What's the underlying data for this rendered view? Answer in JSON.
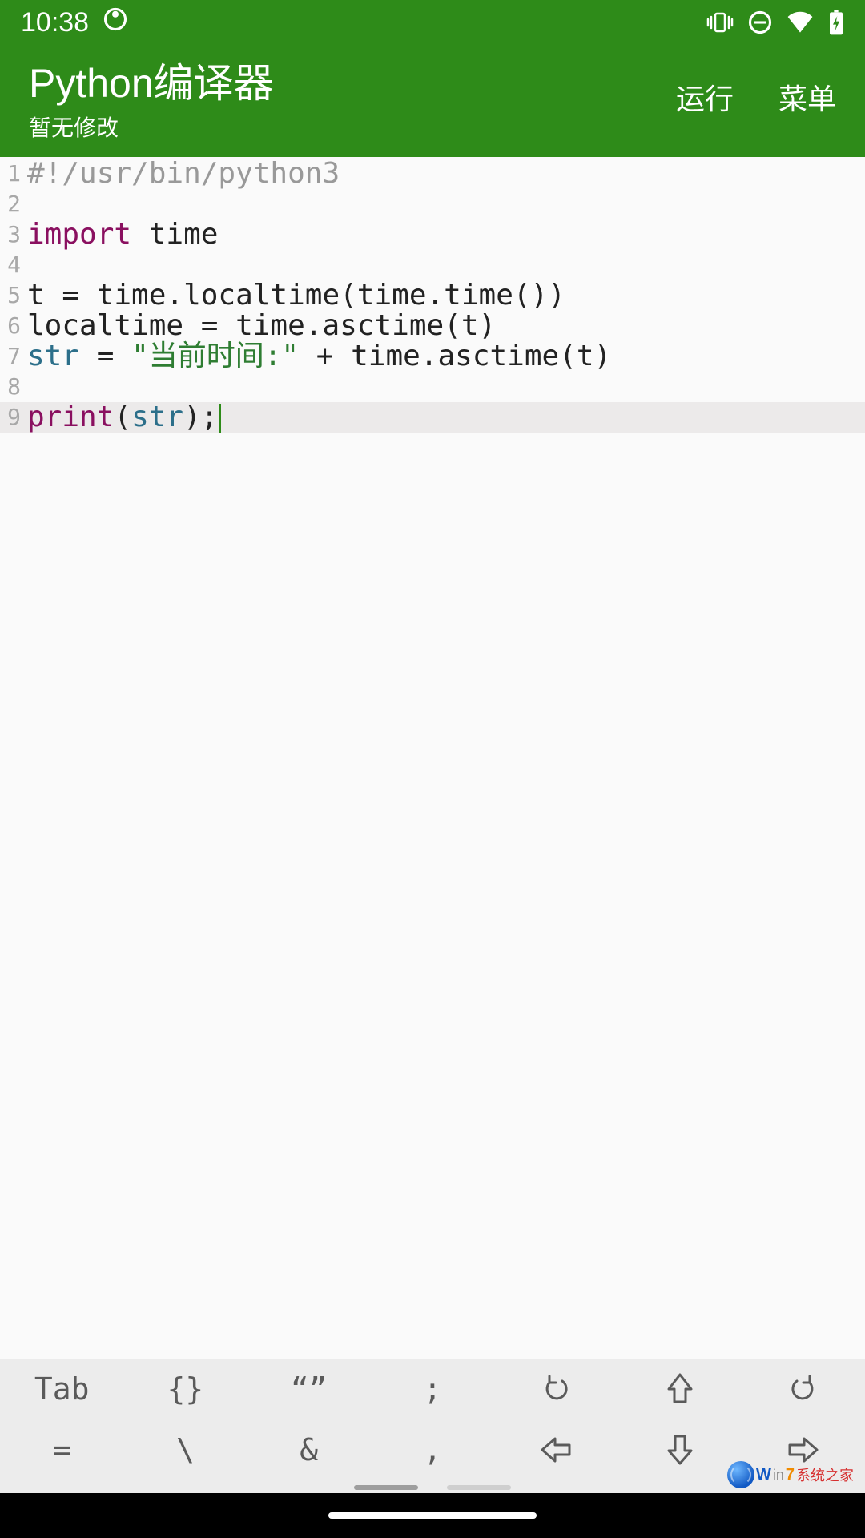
{
  "status": {
    "time": "10:38"
  },
  "header": {
    "title": "Python编译器",
    "subtitle": "暂无修改",
    "run": "运行",
    "menu": "菜单"
  },
  "code": {
    "lines": [
      {
        "n": "1",
        "tokens": [
          {
            "cls": "tk-comment",
            "t": "#!/usr/bin/python3"
          }
        ]
      },
      {
        "n": "2",
        "tokens": []
      },
      {
        "n": "3",
        "tokens": [
          {
            "cls": "tk-keyword",
            "t": "import"
          },
          {
            "cls": "",
            "t": " time"
          }
        ]
      },
      {
        "n": "4",
        "tokens": []
      },
      {
        "n": "5",
        "tokens": [
          {
            "cls": "",
            "t": "t = time.localtime(time.time())"
          }
        ]
      },
      {
        "n": "6",
        "tokens": [
          {
            "cls": "",
            "t": "localtime = time.asctime(t)"
          }
        ]
      },
      {
        "n": "7",
        "tokens": [
          {
            "cls": "tk-builtin",
            "t": "str"
          },
          {
            "cls": "",
            "t": " = "
          },
          {
            "cls": "tk-string",
            "t": "\"当前时间:\""
          },
          {
            "cls": "",
            "t": " + time.asctime(t)"
          }
        ]
      },
      {
        "n": "8",
        "tokens": []
      },
      {
        "n": "9",
        "tokens": [
          {
            "cls": "tk-keyword",
            "t": "print"
          },
          {
            "cls": "",
            "t": "("
          },
          {
            "cls": "tk-builtin",
            "t": "str"
          },
          {
            "cls": "",
            "t": ");"
          }
        ],
        "current": true,
        "cursor": true
      }
    ]
  },
  "accessory": {
    "row1": [
      {
        "label": "Tab",
        "name": "key-tab"
      },
      {
        "label": "{}",
        "name": "key-braces"
      },
      {
        "label": "“”",
        "name": "key-quotes"
      },
      {
        "label": ";",
        "name": "key-semicolon"
      },
      {
        "icon": "undo",
        "name": "key-undo"
      },
      {
        "icon": "shift",
        "name": "key-shift"
      },
      {
        "icon": "redo",
        "name": "key-redo"
      }
    ],
    "row2": [
      {
        "label": "=",
        "name": "key-equals"
      },
      {
        "label": "\\",
        "name": "key-backslash"
      },
      {
        "label": "&",
        "name": "key-ampersand"
      },
      {
        "label": ",",
        "name": "key-comma"
      },
      {
        "icon": "left",
        "name": "key-left"
      },
      {
        "icon": "down",
        "name": "key-down"
      },
      {
        "icon": "right",
        "name": "key-right"
      }
    ]
  },
  "watermark": {
    "w": "W",
    "in": "in",
    "seven": "7",
    "txt": "系统之家"
  }
}
